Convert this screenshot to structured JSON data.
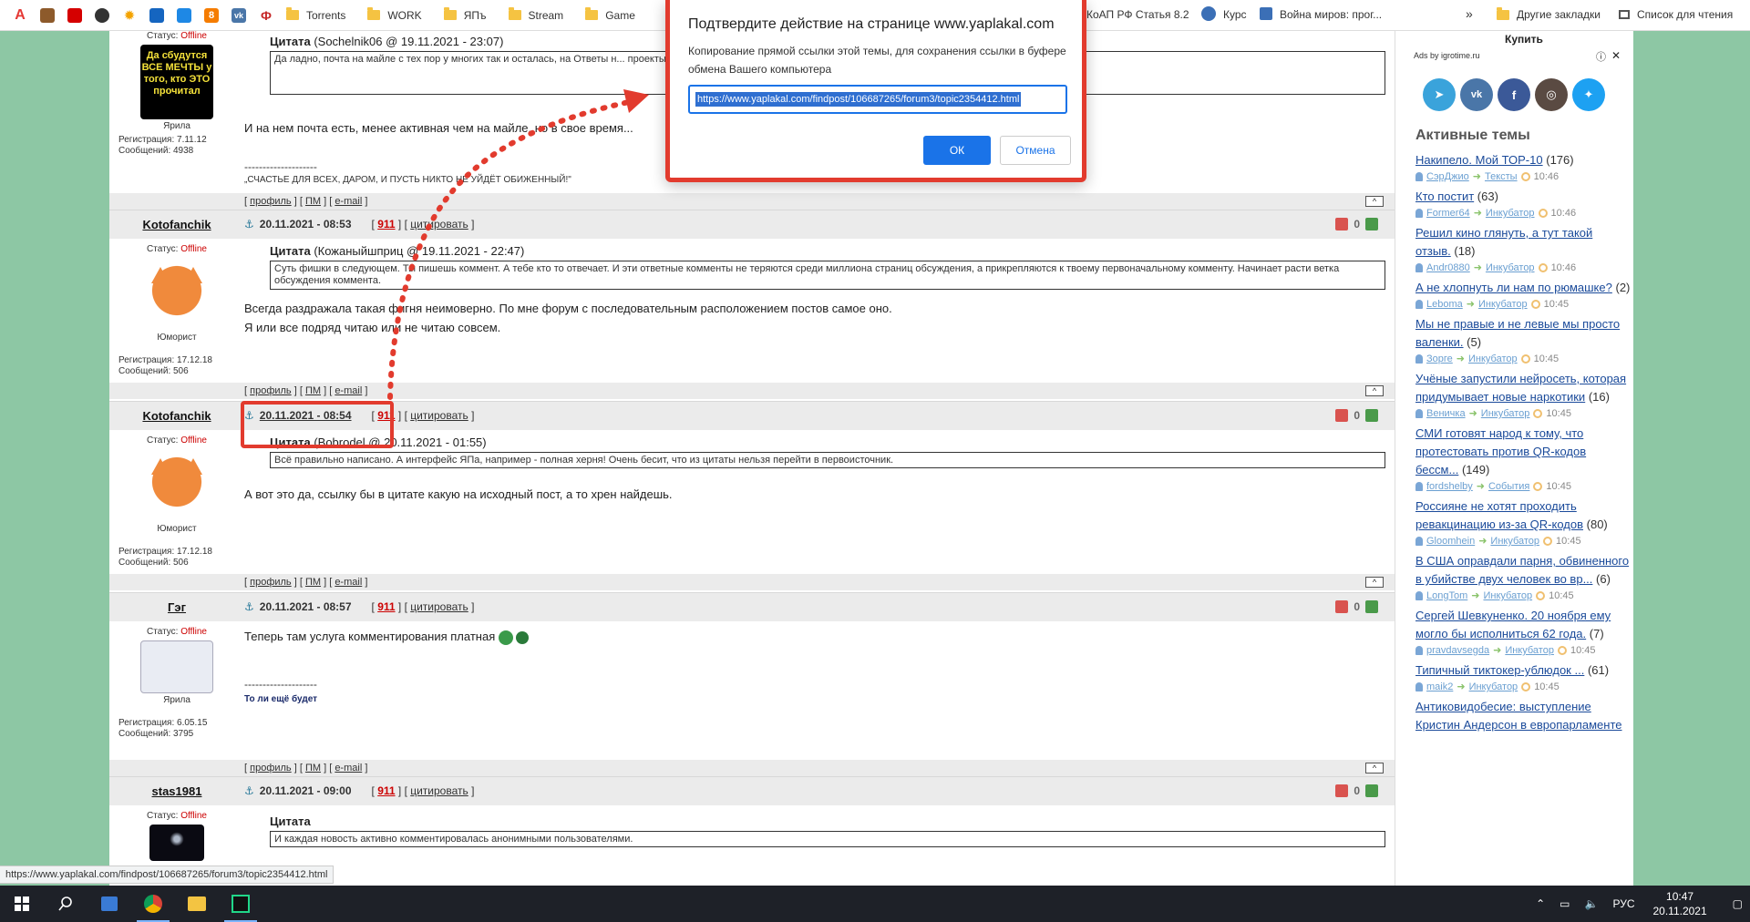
{
  "bookmarks": [
    {
      "label": "",
      "color": "#e53935",
      "glyph": "A"
    },
    {
      "label": "",
      "color": "#8d5a2b",
      "glyph": "▦"
    },
    {
      "label": "",
      "color": "#d50000",
      "glyph": ""
    },
    {
      "label": "",
      "color": "#333333",
      "glyph": "●"
    },
    {
      "label": "",
      "color": "#f4a300",
      "glyph": "✹"
    },
    {
      "label": "",
      "color": "#1565c0",
      "glyph": "◎"
    },
    {
      "label": "",
      "color": "#1e88e5",
      "glyph": "▚"
    },
    {
      "label": "",
      "color": "#f57c00",
      "glyph": "8"
    },
    {
      "label": "",
      "color": "#4a76a8",
      "glyph": "vk"
    },
    {
      "label": "",
      "color": "#c62828",
      "glyph": "Ф"
    }
  ],
  "bookmark_folders": [
    "Torrents",
    "WORK",
    "ЯПъ",
    "Stream",
    "Game"
  ],
  "bookmark_right": [
    "КоАП РФ Статья 8.2",
    "Курс",
    "Война миров: прог..."
  ],
  "bookmark_more": "»",
  "other_bookmarks": "Другие закладки",
  "reading_list": "Список для чтения",
  "dialog": {
    "title": "Подтвердите действие на странице www.yaplakal.com",
    "message": "Копирование прямой ссылки этой темы, для сохранения ссылки в буфере обмена Вашего компьютера",
    "url": "https://www.yaplakal.com/findpost/106687265/forum3/topic2354412.html",
    "ok": "ОК",
    "cancel": "Отмена"
  },
  "posts": [
    {
      "author": "",
      "status_label": "Статус:",
      "status": "Offline",
      "avatar_text": "Да сбудутся ВСЕ МЕЧТЫ у того, кто ЭТО прочитал",
      "rank": "Ярила",
      "reg": "Регистрация: 7.11.12",
      "msgs": "Сообщений: 4938",
      "quote_label": "Цитата",
      "quote_src": "(Sochelnik06 @ 19.11.2021 - 23:07)",
      "quote_text": "Да ладно, почта на майле с тех пор у многих так и осталась, на Ответы н... проекты, как нынче модно. А вот Рамблер был, его сейчас кто-нибудь юзает?",
      "text": "И на нем почта есть, менее активная чем на майле, но в свое время...",
      "sig_sep": "--------------------",
      "sig": "„СЧАСТЬЕ ДЛЯ ВСЕХ, ДАРОМ, И ПУСТЬ НИКТО НЕ УЙДЁТ ОБИЖЕННЫЙ!\""
    },
    {
      "author": "Kotofanchik",
      "status_label": "Статус:",
      "status": "Offline",
      "rank": "Юморист",
      "reg": "Регистрация: 17.12.18",
      "msgs": "Сообщений: 506",
      "date": "20.11.2021 - 08:53",
      "num": "911",
      "cite": "цитировать",
      "rating": "0",
      "quote_label": "Цитата",
      "quote_src": "(Кожаныйшприц @ 19.11.2021 - 22:47)",
      "quote_text": "Суть фишки в следующем. Ты пишешь коммент. А тебе кто то отвечает. И эти ответные комменты не теряются среди миллиона страниц обсуждения, а прикрепляются к твоему первоначальному комменту. Начинает расти ветка обсуждения коммента.",
      "text1": "Всегда раздражала такая фигня неимоверно. По мне форум с последовательным расположением постов самое оно.",
      "text2": "Я или все подряд читаю или не читаю совсем."
    },
    {
      "author": "Kotofanchik",
      "status_label": "Статус:",
      "status": "Offline",
      "rank": "Юморист",
      "reg": "Регистрация: 17.12.18",
      "msgs": "Сообщений: 506",
      "date": "20.11.2021 - 08:54",
      "num": "911",
      "cite": "цитировать",
      "rating": "0",
      "quote_label": "Цитата",
      "quote_src": "(Bobrodel @ 20.11.2021 - 01:55)",
      "quote_text": "Всё правильно написано. А интерфейс ЯПа, например - полная херня! Очень бесит, что из цитаты нельзя перейти в первоисточник.",
      "text": "А вот это да, ссылку бы в цитате какую на исходный пост, а то хрен найдешь."
    },
    {
      "author": "Гэг",
      "status_label": "Статус:",
      "status": "Offline",
      "rank": "Ярила",
      "reg": "Регистрация: 6.05.15",
      "msgs": "Сообщений: 3795",
      "date": "20.11.2021 - 08:57",
      "num": "911",
      "cite": "цитировать",
      "rating": "0",
      "text": "Теперь там услуга комментирования платная",
      "sig_sep": "--------------------",
      "sig": "То ли ещё будет"
    },
    {
      "author": "stas1981",
      "status_label": "Статус:",
      "status": "Offline",
      "date": "20.11.2021 - 09:00",
      "num": "911",
      "cite": "цитировать",
      "rating": "0",
      "quote_label": "Цитата",
      "quote_text": "И каждая новость активно комментировалась анонимными пользователями."
    }
  ],
  "links": {
    "profile": "профиль",
    "pm": "ПМ",
    "email": "e-mail",
    "up": "[^]"
  },
  "sidebar": {
    "buy": "Купить",
    "ads": "Ads by igrotime.ru",
    "title": "Активные темы",
    "topics": [
      {
        "title": "Накипело. Мой ТОР-10",
        "count": "(176)",
        "user": "СэрДжио",
        "cat": "Тексты",
        "time": "10:46"
      },
      {
        "title": "Кто постит",
        "count": "(63)",
        "user": "Former64",
        "cat": "Инкубатор",
        "time": "10:46"
      },
      {
        "title": "Решил кино глянуть, а тут такой отзыв.",
        "count": "(18)",
        "user": "Andr0880",
        "cat": "Инкубатор",
        "time": "10:46"
      },
      {
        "title": "А не хлопнуть ли нам по рюмашке?",
        "count": "(2)",
        "user": "Leboma",
        "cat": "Инкубатор",
        "time": "10:45"
      },
      {
        "title": "Мы не правые и не левые мы просто валенки.",
        "count": "(5)",
        "user": "Зорге",
        "cat": "Инкубатор",
        "time": "10:45"
      },
      {
        "title": "Учёные запустили нейросеть, которая придумывает новые наркотики",
        "count": "(16)",
        "user": "Веничка",
        "cat": "Инкубатор",
        "time": "10:45"
      },
      {
        "title": "СМИ готовят народ к тому, что протестовать против QR-кодов бессм...",
        "count": "(149)",
        "user": "fordshelby",
        "cat": "События",
        "time": "10:45"
      },
      {
        "title": "Россияне не хотят проходить ревакцинацию из-за QR-кодов",
        "count": "(80)",
        "user": "Gloomhein",
        "cat": "Инкубатор",
        "time": "10:45"
      },
      {
        "title": "В США оправдали парня, обвиненного в убийстве двух человек во вр...",
        "count": "(6)",
        "user": "LongTom",
        "cat": "Инкубатор",
        "time": "10:45"
      },
      {
        "title": "Сергей Шевкуненко. 20 ноября ему могло бы исполниться 62 года.",
        "count": "(7)",
        "user": "pravdavsegda",
        "cat": "Инкубатор",
        "time": "10:45"
      },
      {
        "title": "Типичный тиктокер-ублюдок ...",
        "count": "(61)",
        "user": "maik2",
        "cat": "Инкубатор",
        "time": "10:45"
      },
      {
        "title": "Антиковидобесие: выступление Кристин Андерсон в европарламенте",
        "count": "",
        "user": "",
        "cat": "",
        "time": ""
      }
    ]
  },
  "statusbar": "https://www.yaplakal.com/findpost/106687265/forum3/topic2354412.html",
  "taskbar": {
    "lang": "РУС",
    "time": "10:47",
    "date": "20.11.2021"
  },
  "colors": {
    "highlight_red": "#e23b2e",
    "offline_red": "#cc0000",
    "link_blue": "#1f4f93",
    "accent_blue": "#1a73e8"
  }
}
